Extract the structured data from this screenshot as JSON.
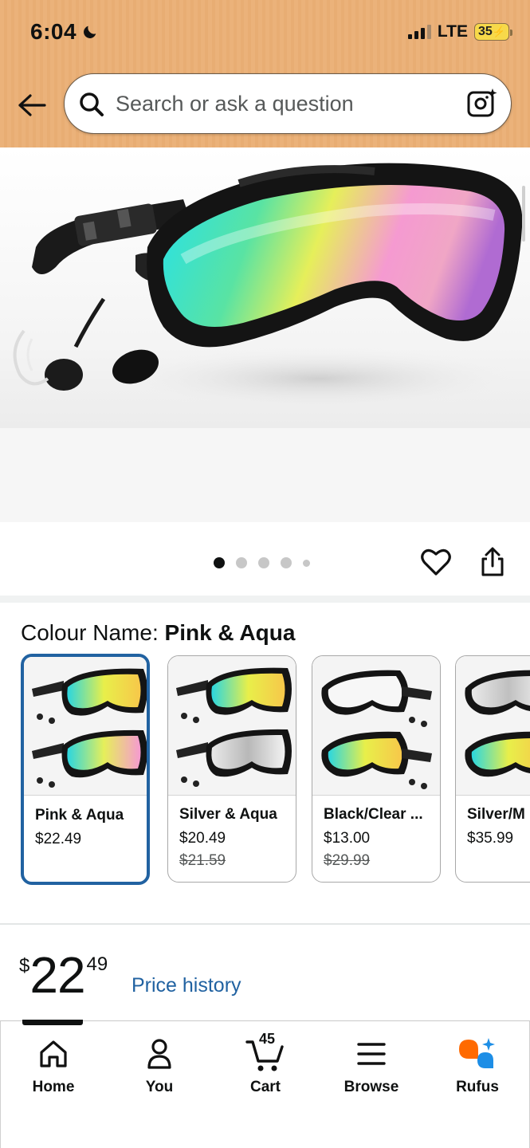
{
  "status_bar": {
    "time": "6:04",
    "network": "LTE",
    "battery": "35"
  },
  "search": {
    "placeholder": "Search or ask a question"
  },
  "gallery": {
    "dot_count": 5,
    "active_index": 0
  },
  "colour": {
    "label": "Colour Name: ",
    "selected": "Pink & Aqua",
    "options": [
      {
        "name": "Pink & Aqua",
        "price": "$22.49",
        "old_price": ""
      },
      {
        "name": "Silver & Aqua",
        "price": "$20.49",
        "old_price": "$21.59"
      },
      {
        "name": "Black/Clear ...",
        "price": "$13.00",
        "old_price": "$29.99"
      },
      {
        "name": "Silver/M",
        "price": "$35.99",
        "old_price": ""
      }
    ]
  },
  "price": {
    "symbol": "$",
    "whole": "22",
    "fraction": "49",
    "history_link": "Price history"
  },
  "nav": {
    "home": "Home",
    "you": "You",
    "cart": "Cart",
    "cart_count": "45",
    "browse": "Browse",
    "rufus": "Rufus"
  },
  "colors": {
    "header_bg": "#ebb27a",
    "link": "#2162a1",
    "selected_border": "#2162a1",
    "rufus_orange": "#ff6a00",
    "rufus_blue": "#1d8ee6"
  }
}
